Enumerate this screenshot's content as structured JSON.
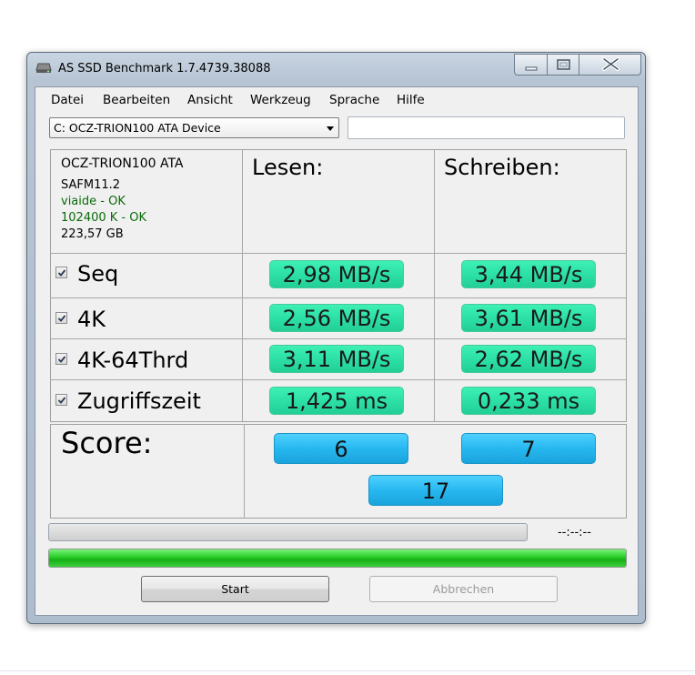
{
  "window": {
    "title": "AS SSD Benchmark 1.7.4739.38088"
  },
  "menu": [
    "Datei",
    "Bearbeiten",
    "Ansicht",
    "Werkzeug",
    "Sprache",
    "Hilfe"
  ],
  "drive": {
    "selected": "C: OCZ-TRION100 ATA Device",
    "path_value": ""
  },
  "info": {
    "name": "OCZ-TRION100 ATA",
    "firmware": "SAFM11.2",
    "driver_status": "viaide - OK",
    "alignment_status": "102400 K - OK",
    "size": "223,57 GB"
  },
  "columns": {
    "read": "Lesen:",
    "write": "Schreiben:"
  },
  "rows": [
    {
      "label": "Seq",
      "checked": true,
      "read": "2,98 MB/s",
      "write": "3,44 MB/s"
    },
    {
      "label": "4K",
      "checked": true,
      "read": "2,56 MB/s",
      "write": "3,61 MB/s"
    },
    {
      "label": "4K-64Thrd",
      "checked": true,
      "read": "3,11 MB/s",
      "write": "2,62 MB/s"
    },
    {
      "label": "Zugriffszeit",
      "checked": true,
      "read": "1,425 ms",
      "write": "0,233 ms"
    }
  ],
  "score": {
    "label": "Score:",
    "read": "6",
    "write": "7",
    "total": "17"
  },
  "progress": {
    "test_fraction": 0,
    "time": "--:--:--",
    "total_fraction": 1.0
  },
  "buttons": {
    "start": "Start",
    "cancel": "Abbrechen"
  },
  "colors": {
    "result_green": "#2ee2a8",
    "score_blue": "#27b8f0",
    "progress_green": "#16b016",
    "status_ok": "#0b6b0b"
  }
}
